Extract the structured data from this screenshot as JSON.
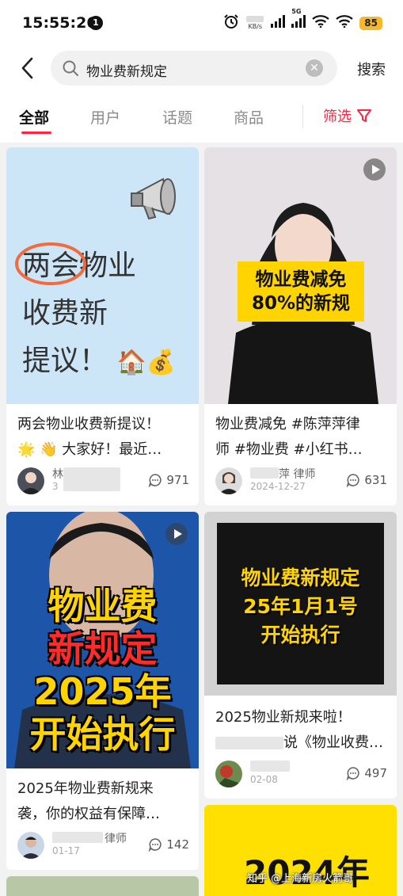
{
  "status": {
    "time": "15:55:26",
    "notification_count": "1",
    "speed_unit": "KB/s",
    "network": "5G",
    "battery": "85"
  },
  "search": {
    "query": "物业费新规定",
    "button_label": "搜索"
  },
  "tabs": [
    {
      "label": "全部",
      "active": true
    },
    {
      "label": "用户",
      "active": false
    },
    {
      "label": "话题",
      "active": false
    },
    {
      "label": "商品",
      "active": false
    }
  ],
  "filter_label": "筛选",
  "accent_color": "#ff2442",
  "cards": [
    {
      "cover_text": [
        "两会物业",
        "收费新",
        "提议！"
      ],
      "title_line1": "两会物业收费新提议！",
      "title_line2": "🌟 👋 大家好！最近…",
      "author_name": "林",
      "author_date": "3",
      "comments": "971"
    },
    {
      "cover_text": [
        "物业费减免",
        "80%的新规"
      ],
      "title_line1": "物业费减免 #陈萍萍律",
      "title_line2": "师 #物业费 #小红书…",
      "author_name": "萍 律师",
      "author_date": "2024-12-27",
      "comments": "631"
    },
    {
      "cover_text": [
        "物业费",
        "新规定",
        "2025年",
        "开始执行"
      ],
      "title_line1": "2025年物业费新规来",
      "title_line2": "袭，你的权益有保障…",
      "author_name": "律师",
      "author_date": "01-17",
      "comments": "142"
    },
    {
      "cover_text": [
        "物业费新规定",
        "25年1月1号",
        "开始执行"
      ],
      "title_line1": "2025物业新规来啦！",
      "title_line2": "说《物业收费…",
      "author_name": "",
      "author_date": "02-08",
      "comments": "497"
    },
    {
      "cover_text": [
        "2024年"
      ]
    }
  ],
  "watermark": "知乎 @上海新房火箭哥"
}
